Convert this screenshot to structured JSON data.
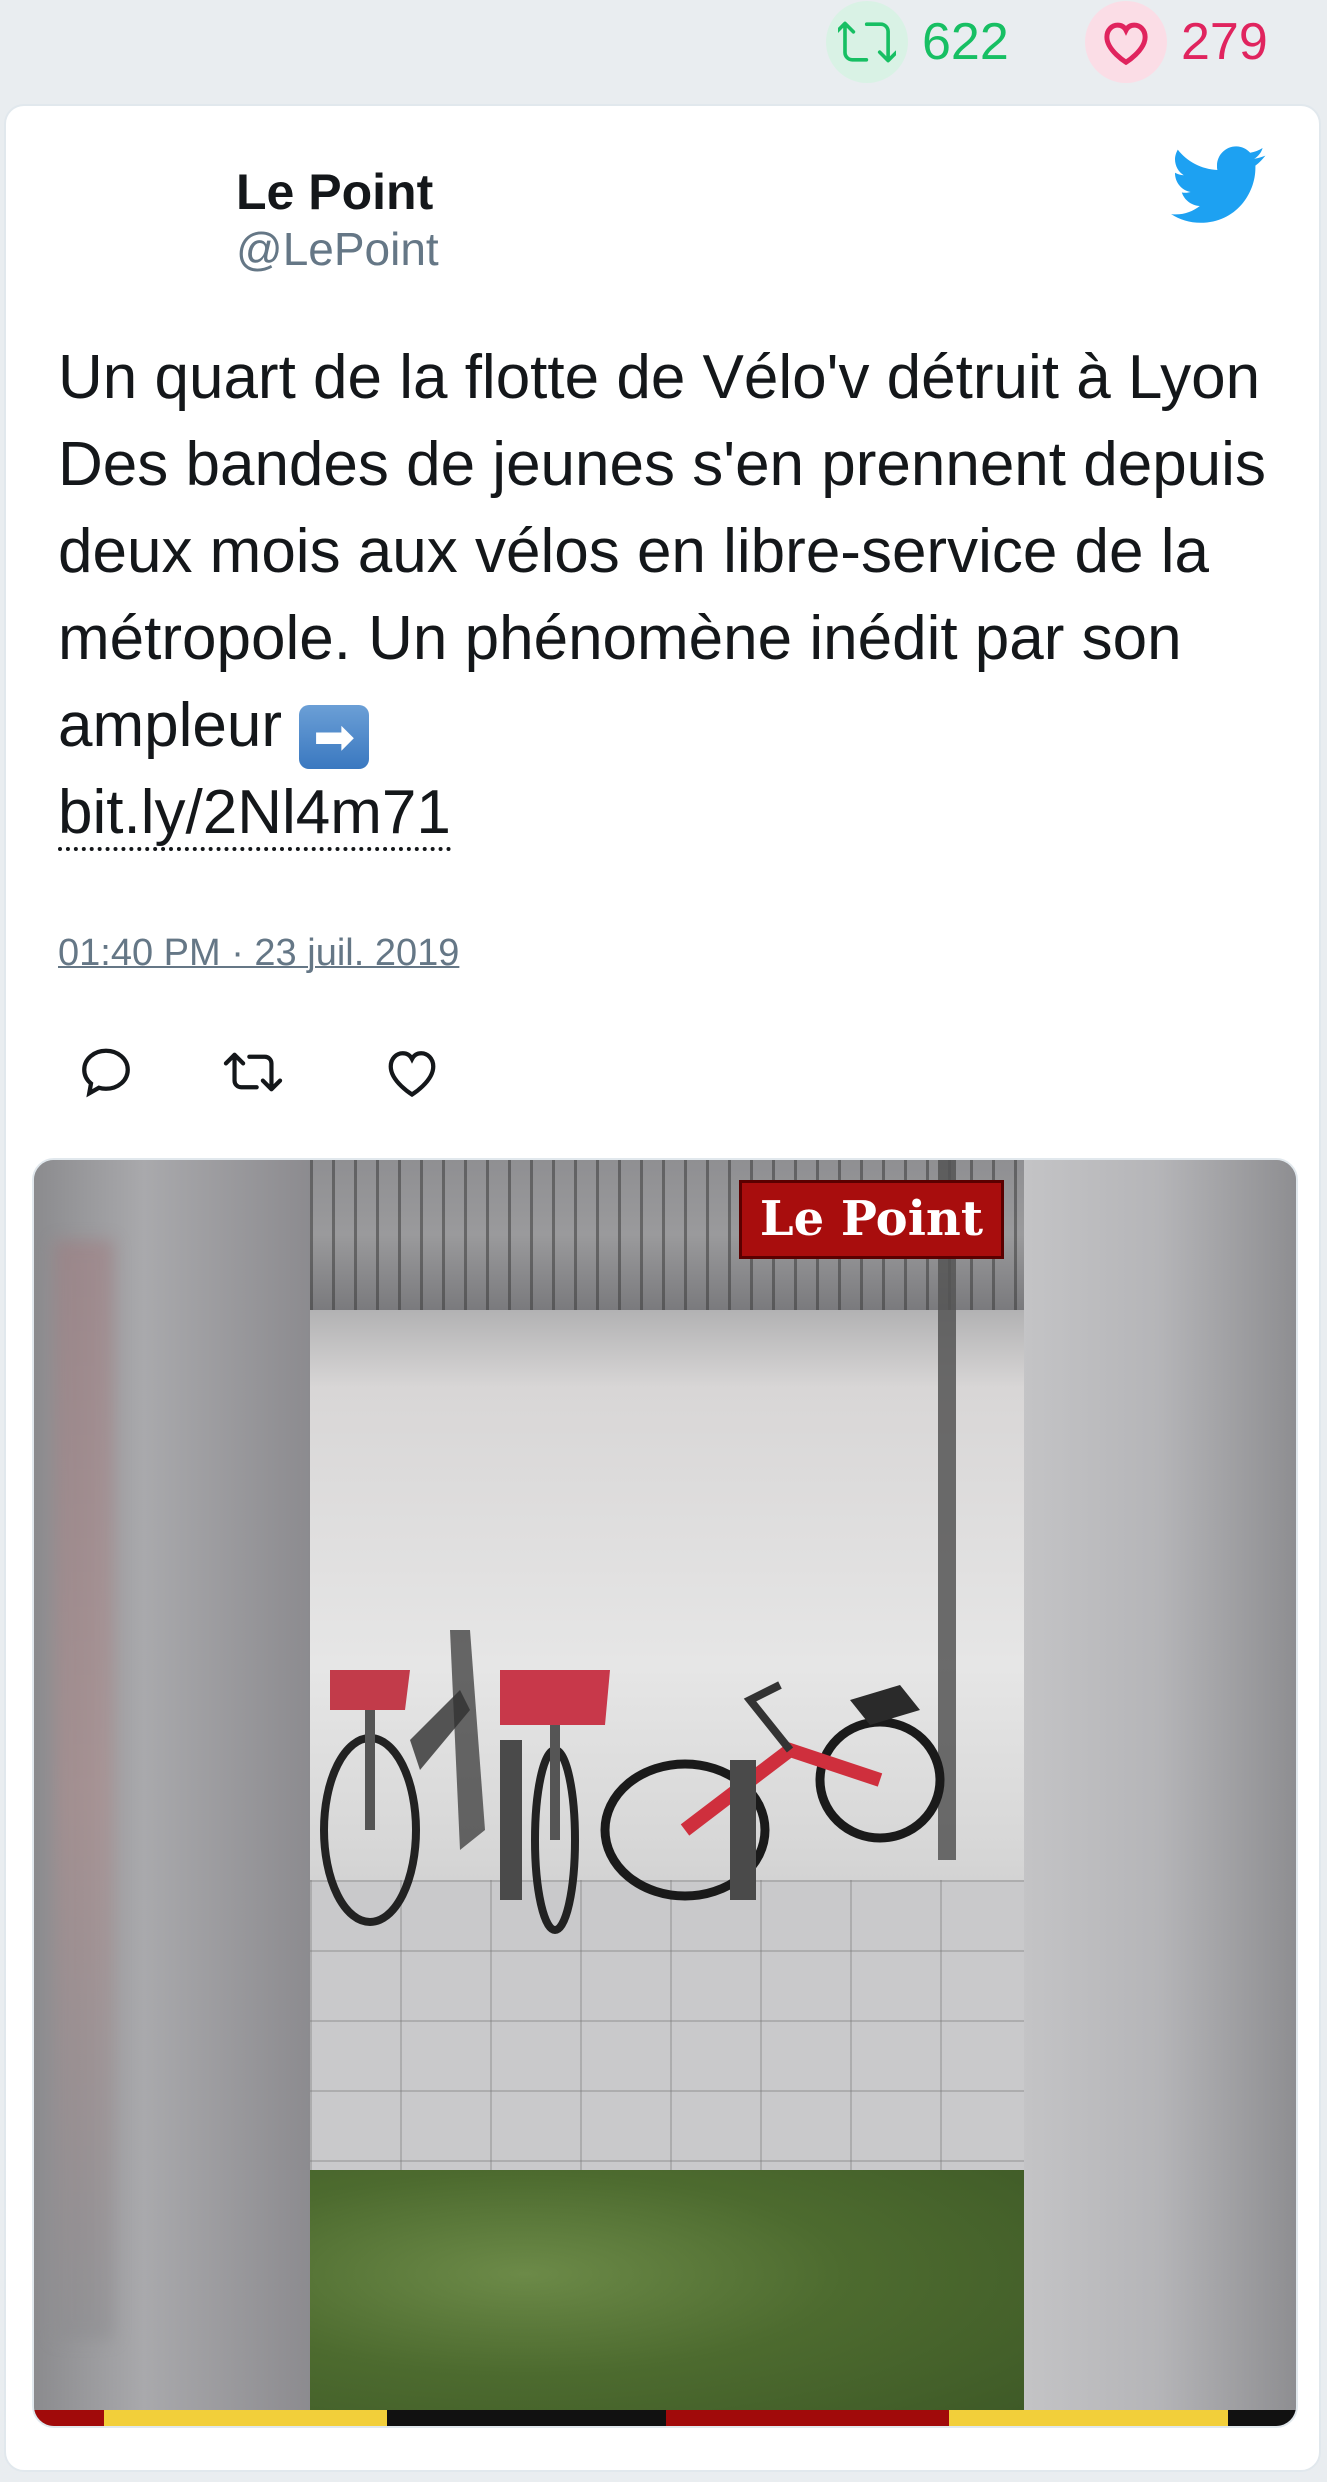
{
  "stats": {
    "retweets": "622",
    "likes": "279"
  },
  "author": {
    "name": "Le Point",
    "handle": "@LePoint"
  },
  "tweet": {
    "text": "Un quart de la flotte de Vélo'v détruit à Lyon Des bandes de jeunes s'en prennent depuis deux mois aux vélos en libre-service de la métropole. Un phénomène inédit par son ampleur ",
    "emoji": "➡",
    "link": "bit.ly/2Nl4m71",
    "timestamp": "01:40 PM · 23 juil. 2019"
  },
  "media": {
    "watermark": "Le Point"
  },
  "colors": {
    "retweet": "#17bf63",
    "like": "#e0245e",
    "twitter_blue": "#1da1f2",
    "muted": "#657786"
  },
  "icons": {
    "retweet": "retweet-icon",
    "like": "heart-icon",
    "reply": "reply-icon",
    "brand": "twitter-bird-icon"
  }
}
